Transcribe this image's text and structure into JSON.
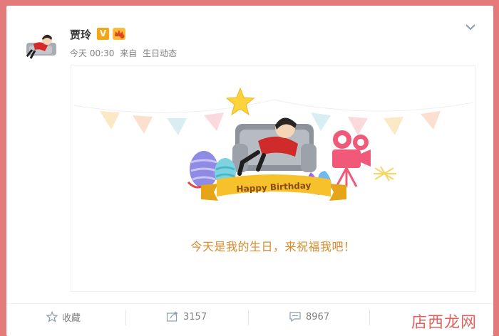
{
  "post": {
    "author": "贾玲",
    "verified_badge": "V",
    "time": "今天 00:30",
    "source_prefix": "来自",
    "source": "生日动态"
  },
  "card": {
    "banner_text": "Happy Birthday",
    "blessing": "今天是我的生日，来祝福我吧！"
  },
  "actions": {
    "favorite_label": "收藏",
    "repost_count": "3157",
    "comment_count": "8967"
  },
  "watermark": "店西龙网",
  "icons": {
    "menu": "chevron-down-icon",
    "favorite": "star-outline-icon",
    "repost": "share-arrow-icon",
    "comment": "speech-bubble-icon"
  },
  "colors": {
    "page_border": "#e47a7a",
    "accent_text": "#d98a2a",
    "ribbon": "#f6c12a",
    "verified": "#f7a515"
  }
}
